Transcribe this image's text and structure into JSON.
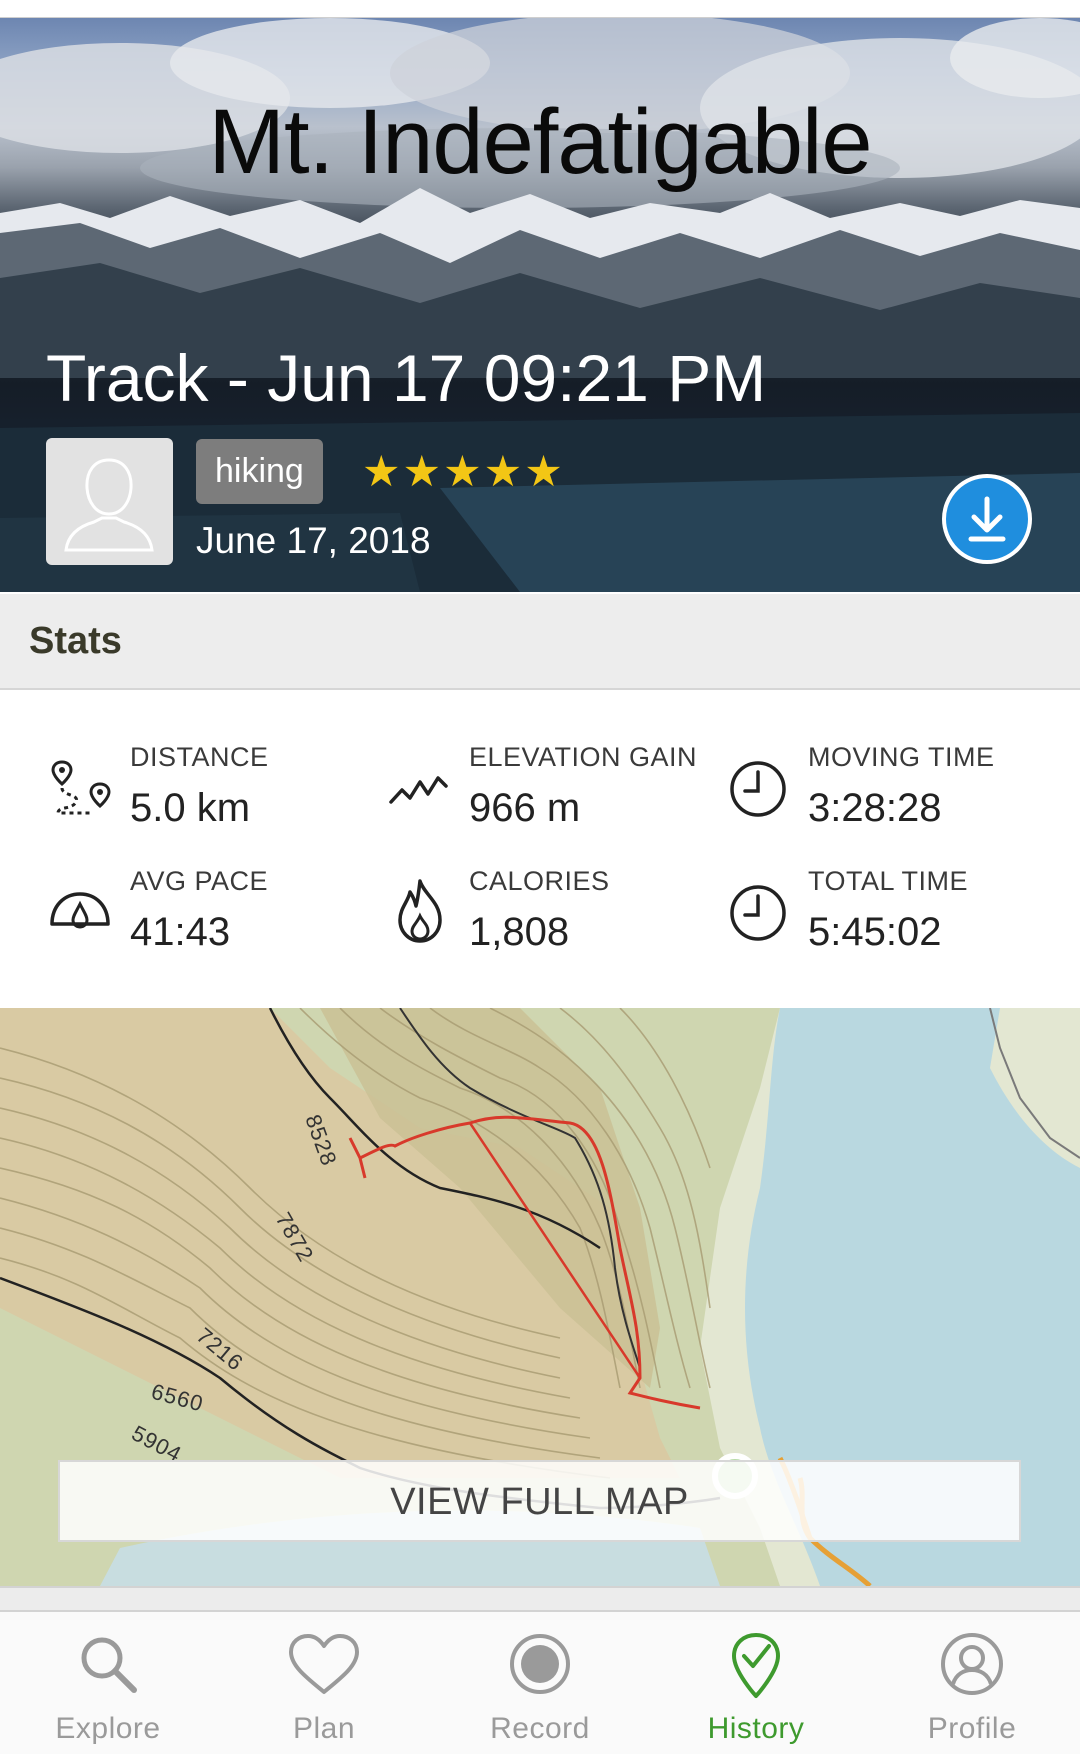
{
  "hero": {
    "overlay_title": "Mt. Indefatigable",
    "track_title": "Track - Jun 17 09:21 PM",
    "activity": "hiking",
    "rating_stars": "★★★★★",
    "rating": 5,
    "date": "June 17, 2018",
    "download_icon": "download-circle-icon"
  },
  "stats": {
    "header": "Stats",
    "items": [
      {
        "label": "DISTANCE",
        "value": "5.0 km",
        "icon": "distance-pin-icon"
      },
      {
        "label": "ELEVATION GAIN",
        "value": "966 m",
        "icon": "elevation-zigzag-icon"
      },
      {
        "label": "MOVING TIME",
        "value": "3:28:28",
        "icon": "clock-icon"
      },
      {
        "label": "AVG PACE",
        "value": "41:43",
        "icon": "speedometer-icon"
      },
      {
        "label": "CALORIES",
        "value": "1,808",
        "icon": "flame-icon"
      },
      {
        "label": "TOTAL TIME",
        "value": "5:45:02",
        "icon": "clock-icon"
      }
    ]
  },
  "map": {
    "contour_labels": [
      "8528",
      "7872",
      "7216",
      "6560",
      "5904"
    ],
    "button_label": "VIEW FULL MAP",
    "track_color": "#d8392b"
  },
  "tabbar": {
    "tabs": [
      {
        "label": "Explore",
        "icon": "search-icon",
        "active": false
      },
      {
        "label": "Plan",
        "icon": "heart-icon",
        "active": false
      },
      {
        "label": "Record",
        "icon": "record-icon",
        "active": false
      },
      {
        "label": "History",
        "icon": "history-check-pin-icon",
        "active": true
      },
      {
        "label": "Profile",
        "icon": "profile-icon",
        "active": false
      }
    ],
    "active_color": "#3e9a2e",
    "inactive_color": "#9a9a9a"
  }
}
